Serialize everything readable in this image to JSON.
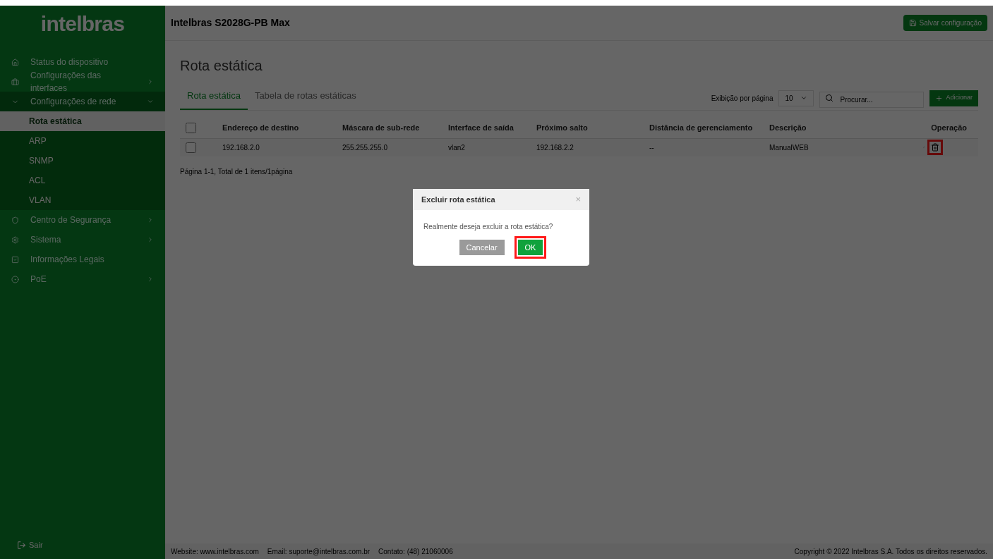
{
  "sidebar": {
    "logo": "intelbras",
    "items": [
      {
        "kind": "link",
        "label": "Status do dispositivo"
      },
      {
        "kind": "group",
        "label": "Configurações das interfaces",
        "expanded": false
      },
      {
        "kind": "group",
        "label": "Configurações de rede",
        "expanded": true,
        "children": [
          {
            "label": "Rota estática",
            "selected": true
          },
          {
            "label": "ARP",
            "selected": false
          },
          {
            "label": "SNMP",
            "selected": false
          },
          {
            "label": "ACL",
            "selected": false
          },
          {
            "label": "VLAN",
            "selected": false
          }
        ]
      },
      {
        "kind": "group",
        "label": "Centro de Segurança",
        "expanded": false
      },
      {
        "kind": "group",
        "label": "Sistema",
        "expanded": false
      },
      {
        "kind": "link",
        "label": "Informações Legais"
      },
      {
        "kind": "group",
        "label": "PoE",
        "expanded": false
      }
    ],
    "logout": "Sair"
  },
  "header": {
    "title": "Intelbras S2028G-PB Max",
    "save_button": "Salvar configuração"
  },
  "page_title": "Rota estática",
  "tabs": [
    {
      "label": "Rota estática",
      "selected": true
    },
    {
      "label": "Tabela de rotas estáticas",
      "selected": false
    }
  ],
  "toolbar": {
    "per_page_label": "Exibição por página",
    "per_page_value": "10",
    "search": {
      "placeholder": "Procurar..."
    },
    "add_button": "Adicionar"
  },
  "table": {
    "columns": [
      "Endereço de destino",
      "Máscara de sub-rede",
      "Interface de saída",
      "Próximo salto",
      "Distância de gerenciamento",
      "Descrição",
      "Operação"
    ],
    "header_checked": false,
    "rows": [
      {
        "checked": false,
        "cells": [
          "192.168.2.0",
          "255.255.255.0",
          "vlan2",
          "192.168.2.2",
          "--",
          "ManualWEB"
        ],
        "delete_highlighted": true
      }
    ]
  },
  "pagination": "Página 1-1, Total de 1 itens/1página",
  "dialog": {
    "title": "Excluir rota estática",
    "close": "×",
    "message": "Realmente deseja excluir a rota estática?",
    "buttons": [
      {
        "kind": "secondary",
        "label": "Cancelar",
        "highlighted": false
      },
      {
        "kind": "primary",
        "label": "OK",
        "highlighted": true
      }
    ]
  },
  "footer": {
    "left": [
      "Website: www.intelbras.com",
      "Email: suporte@intelbras.com.br",
      "Contato: (48) 21060006"
    ],
    "right": "Copyright © 2022 Intelbras S.A. Todos os direitos reservados."
  }
}
